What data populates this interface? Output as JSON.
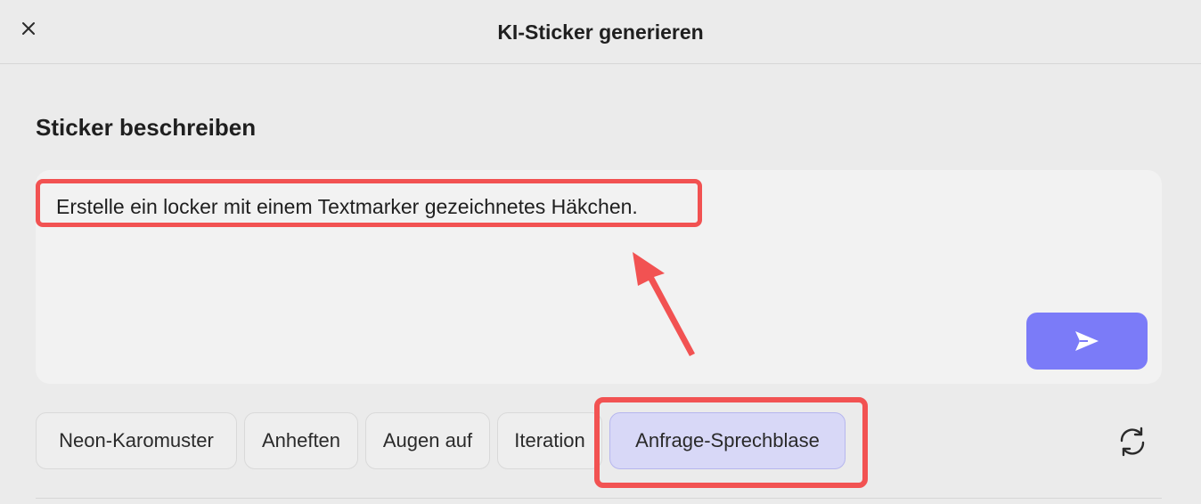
{
  "header": {
    "title": "KI-Sticker generieren",
    "close_icon": "close-icon"
  },
  "section": {
    "title": "Sticker beschreiben"
  },
  "prompt": {
    "value": "Erstelle ein locker mit einem Textmarker gezeichnetes Häkchen."
  },
  "send": {
    "icon": "send-icon",
    "color": "#7b7bf8"
  },
  "chips": [
    {
      "label": "Neon-Karomuster",
      "selected": false
    },
    {
      "label": "Anheften",
      "selected": false
    },
    {
      "label": "Augen auf",
      "selected": false
    },
    {
      "label": "Iteration",
      "selected": false
    },
    {
      "label": "Anfrage-Sprechblase",
      "selected": true
    }
  ],
  "refresh": {
    "icon": "refresh-icon"
  },
  "annotations": {
    "highlight_color": "#f25252"
  }
}
